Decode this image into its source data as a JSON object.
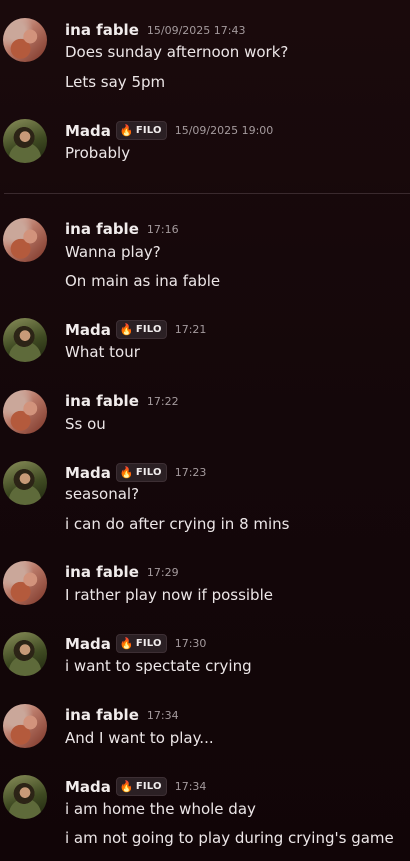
{
  "messages": [
    {
      "author": "ina fable",
      "badge": "",
      "time": "15/09/2025 17:43",
      "lines": [
        "Does sunday  afternoon work?",
        "Lets say 5pm"
      ]
    },
    {
      "author": "Mada",
      "badge": "FILO",
      "time": "15/09/2025 19:00",
      "lines": [
        "Probably"
      ]
    },
    {
      "author": "ina fable",
      "badge": "",
      "time": "17:16",
      "lines": [
        "Wanna play?",
        "On main as ina fable"
      ]
    },
    {
      "author": "Mada",
      "badge": "FILO",
      "time": "17:21",
      "lines": [
        "What tour"
      ]
    },
    {
      "author": "ina fable",
      "badge": "",
      "time": "17:22",
      "lines": [
        "Ss ou"
      ]
    },
    {
      "author": "Mada",
      "badge": "FILO",
      "time": "17:23",
      "lines": [
        "seasonal?",
        "i can do after crying in 8 mins"
      ]
    },
    {
      "author": "ina fable",
      "badge": "",
      "time": "17:29",
      "lines": [
        "I rather play now if possible"
      ]
    },
    {
      "author": "Mada",
      "badge": "FILO",
      "time": "17:30",
      "lines": [
        "i want to spectate crying"
      ]
    },
    {
      "author": "ina fable",
      "badge": "",
      "time": "17:34",
      "lines": [
        "And I want to play..."
      ]
    },
    {
      "author": "Mada",
      "badge": "FILO",
      "time": "17:34",
      "lines": [
        "i am home the whole day",
        "i am not going to play during crying's game"
      ]
    }
  ],
  "icons": {
    "badge_icon": "flame-icon",
    "badge_color": "#f0892d"
  }
}
